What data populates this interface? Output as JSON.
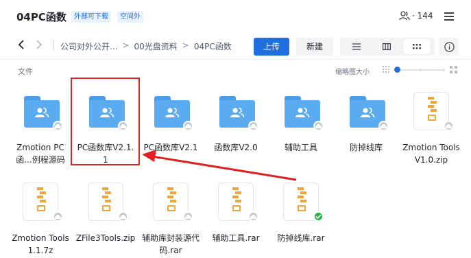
{
  "header": {
    "title": "04PC函数",
    "badges": [
      "外部可下载",
      "空间外"
    ],
    "member_count": "· 144"
  },
  "toolbar": {
    "breadcrumbs": [
      "公司对外公开...",
      "00光盘资料",
      "04PC函数"
    ],
    "upload_label": "上传",
    "new_label": "新建"
  },
  "content": {
    "section_label": "文件",
    "thumb_size_label": "缩略图大小",
    "thumb_size_level": 0
  },
  "files": [
    {
      "name": "Zmotion PC函...例程源码",
      "type": "shared-folder",
      "status": "cloud"
    },
    {
      "name": "PC函数库V2.1.1",
      "type": "shared-folder",
      "status": "cloud",
      "highlighted": true
    },
    {
      "name": "PC函数库V2.1",
      "type": "shared-folder",
      "status": "cloud"
    },
    {
      "name": "函数库V2.0",
      "type": "shared-folder",
      "status": "cloud"
    },
    {
      "name": "辅助工具",
      "type": "shared-folder",
      "status": "cloud"
    },
    {
      "name": "防掉线库",
      "type": "shared-folder",
      "status": "cloud"
    },
    {
      "name": "Zmotion Tools V1.0.zip",
      "type": "zip",
      "status": "cloud"
    },
    {
      "name": "Zmotion Tools1.1.7z",
      "type": "zip",
      "status": "cloud"
    },
    {
      "name": "ZFile3Tools.zip",
      "type": "zip",
      "status": "cloud"
    },
    {
      "name": "辅助库封装源代码.rar",
      "type": "zip",
      "status": "cloud"
    },
    {
      "name": "辅助工具.rar",
      "type": "zip",
      "status": "cloud"
    },
    {
      "name": "防掉线库.rar",
      "type": "zip",
      "status": "synced"
    }
  ],
  "colors": {
    "accent": "#1f6fde",
    "folder": "#5aabf0",
    "zip": "#f0a53a",
    "annotation": "#e02020",
    "synced": "#2bb046"
  },
  "icons": [
    "chevron-left-icon",
    "chevron-right-icon",
    "members-icon",
    "menu-icon",
    "list-view-icon",
    "column-view-icon",
    "grid-view-icon",
    "info-icon",
    "cloud-icon",
    "check-icon"
  ]
}
